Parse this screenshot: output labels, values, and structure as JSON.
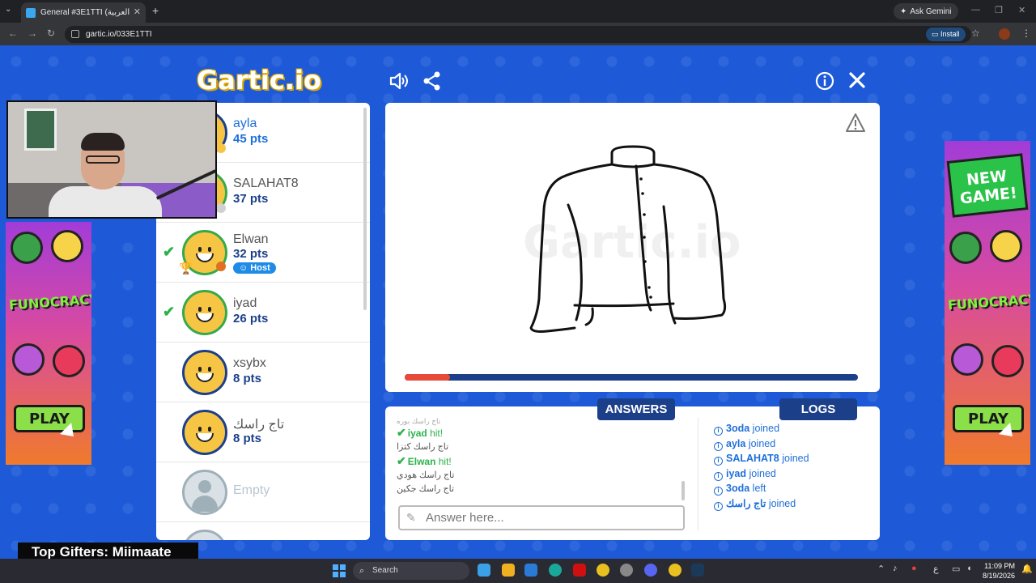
{
  "browser": {
    "tab_title": "General #3E1TTI (العربية) - Gartic",
    "tab_close": "✕",
    "new_tab": "+",
    "ask_gemini": "Ask Gemini",
    "url": "gartic.io/033E1TTI",
    "install": "Install"
  },
  "header": {
    "logo": "Gartic.io"
  },
  "players": [
    {
      "name": "ayla",
      "pts": "45 pts",
      "checked": false
    },
    {
      "name": "SALAHAT8",
      "pts": "37 pts",
      "checked": false
    },
    {
      "name": "Elwan",
      "pts": "32 pts",
      "checked": true,
      "host_label": "Host"
    },
    {
      "name": "iyad",
      "pts": "26 pts",
      "checked": true
    },
    {
      "name": "xsybx",
      "pts": "8 pts",
      "checked": false
    },
    {
      "name": "تاج راسك",
      "pts": "8 pts",
      "checked": false
    },
    {
      "name": "Empty",
      "pts": "",
      "checked": false
    }
  ],
  "ads": {
    "new_game": "NEW GAME!",
    "funocracy": "FUNOCRACY",
    "play": "PLAY"
  },
  "canvas": {
    "watermark": "Gartic.io",
    "timer_progress": 0.1
  },
  "chat": {
    "answers_tab": "ANSWERS",
    "logs_tab": "LOGS",
    "answer_placeholder": "Answer here...",
    "messages": [
      {
        "text": "تاج راسك بوره",
        "type": "faded"
      },
      {
        "name": "iyad",
        "text": " hit!",
        "type": "hit"
      },
      {
        "text": "تاج راسك كتزا",
        "type": "plain"
      },
      {
        "name": "Elwan",
        "text": " hit!",
        "type": "hit"
      },
      {
        "text": "تاج راسك هودي",
        "type": "plain"
      },
      {
        "text": "تاج راسك جكين",
        "type": "plain"
      }
    ],
    "logs": [
      {
        "name": "3oda",
        "action": " joined"
      },
      {
        "name": "ayla",
        "action": " joined"
      },
      {
        "name": "SALAHAT8",
        "action": " joined"
      },
      {
        "name": "iyad",
        "action": " joined"
      },
      {
        "name": "3oda",
        "action": " left"
      },
      {
        "name": "تاج راسك",
        "action": " joined"
      }
    ]
  },
  "overlay": {
    "top_gifters": "Top Gifters: Miimaate"
  },
  "taskbar": {
    "search": "Search",
    "time": "11:09 PM",
    "date": "8/19/2026",
    "lang": "ع"
  },
  "colors": {
    "page_bg": "#1e5ad8",
    "navy": "#1c3f8a",
    "hit_green": "#2bb24c",
    "timer_red": "#e84a3a"
  }
}
